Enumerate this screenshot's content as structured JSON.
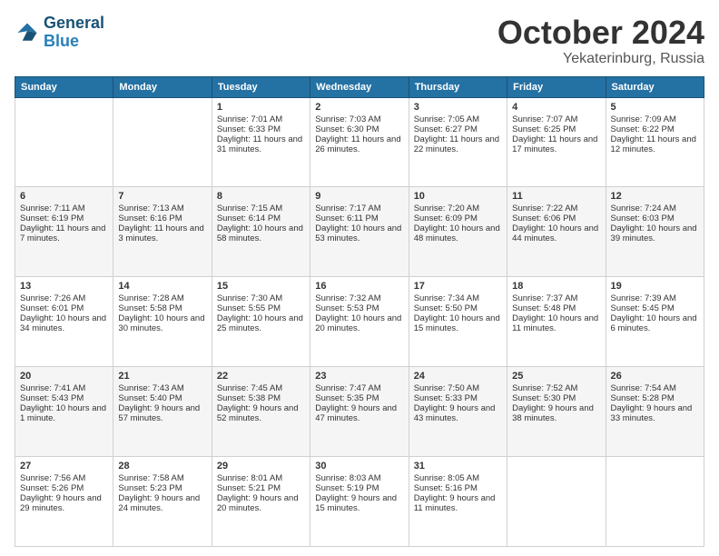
{
  "logo": {
    "line1": "General",
    "line2": "Blue"
  },
  "header": {
    "month": "October 2024",
    "location": "Yekaterinburg, Russia"
  },
  "weekdays": [
    "Sunday",
    "Monday",
    "Tuesday",
    "Wednesday",
    "Thursday",
    "Friday",
    "Saturday"
  ],
  "weeks": [
    [
      {
        "day": "",
        "data": ""
      },
      {
        "day": "",
        "data": ""
      },
      {
        "day": "1",
        "data": "Sunrise: 7:01 AM\nSunset: 6:33 PM\nDaylight: 11 hours and 31 minutes."
      },
      {
        "day": "2",
        "data": "Sunrise: 7:03 AM\nSunset: 6:30 PM\nDaylight: 11 hours and 26 minutes."
      },
      {
        "day": "3",
        "data": "Sunrise: 7:05 AM\nSunset: 6:27 PM\nDaylight: 11 hours and 22 minutes."
      },
      {
        "day": "4",
        "data": "Sunrise: 7:07 AM\nSunset: 6:25 PM\nDaylight: 11 hours and 17 minutes."
      },
      {
        "day": "5",
        "data": "Sunrise: 7:09 AM\nSunset: 6:22 PM\nDaylight: 11 hours and 12 minutes."
      }
    ],
    [
      {
        "day": "6",
        "data": "Sunrise: 7:11 AM\nSunset: 6:19 PM\nDaylight: 11 hours and 7 minutes."
      },
      {
        "day": "7",
        "data": "Sunrise: 7:13 AM\nSunset: 6:16 PM\nDaylight: 11 hours and 3 minutes."
      },
      {
        "day": "8",
        "data": "Sunrise: 7:15 AM\nSunset: 6:14 PM\nDaylight: 10 hours and 58 minutes."
      },
      {
        "day": "9",
        "data": "Sunrise: 7:17 AM\nSunset: 6:11 PM\nDaylight: 10 hours and 53 minutes."
      },
      {
        "day": "10",
        "data": "Sunrise: 7:20 AM\nSunset: 6:09 PM\nDaylight: 10 hours and 48 minutes."
      },
      {
        "day": "11",
        "data": "Sunrise: 7:22 AM\nSunset: 6:06 PM\nDaylight: 10 hours and 44 minutes."
      },
      {
        "day": "12",
        "data": "Sunrise: 7:24 AM\nSunset: 6:03 PM\nDaylight: 10 hours and 39 minutes."
      }
    ],
    [
      {
        "day": "13",
        "data": "Sunrise: 7:26 AM\nSunset: 6:01 PM\nDaylight: 10 hours and 34 minutes."
      },
      {
        "day": "14",
        "data": "Sunrise: 7:28 AM\nSunset: 5:58 PM\nDaylight: 10 hours and 30 minutes."
      },
      {
        "day": "15",
        "data": "Sunrise: 7:30 AM\nSunset: 5:55 PM\nDaylight: 10 hours and 25 minutes."
      },
      {
        "day": "16",
        "data": "Sunrise: 7:32 AM\nSunset: 5:53 PM\nDaylight: 10 hours and 20 minutes."
      },
      {
        "day": "17",
        "data": "Sunrise: 7:34 AM\nSunset: 5:50 PM\nDaylight: 10 hours and 15 minutes."
      },
      {
        "day": "18",
        "data": "Sunrise: 7:37 AM\nSunset: 5:48 PM\nDaylight: 10 hours and 11 minutes."
      },
      {
        "day": "19",
        "data": "Sunrise: 7:39 AM\nSunset: 5:45 PM\nDaylight: 10 hours and 6 minutes."
      }
    ],
    [
      {
        "day": "20",
        "data": "Sunrise: 7:41 AM\nSunset: 5:43 PM\nDaylight: 10 hours and 1 minute."
      },
      {
        "day": "21",
        "data": "Sunrise: 7:43 AM\nSunset: 5:40 PM\nDaylight: 9 hours and 57 minutes."
      },
      {
        "day": "22",
        "data": "Sunrise: 7:45 AM\nSunset: 5:38 PM\nDaylight: 9 hours and 52 minutes."
      },
      {
        "day": "23",
        "data": "Sunrise: 7:47 AM\nSunset: 5:35 PM\nDaylight: 9 hours and 47 minutes."
      },
      {
        "day": "24",
        "data": "Sunrise: 7:50 AM\nSunset: 5:33 PM\nDaylight: 9 hours and 43 minutes."
      },
      {
        "day": "25",
        "data": "Sunrise: 7:52 AM\nSunset: 5:30 PM\nDaylight: 9 hours and 38 minutes."
      },
      {
        "day": "26",
        "data": "Sunrise: 7:54 AM\nSunset: 5:28 PM\nDaylight: 9 hours and 33 minutes."
      }
    ],
    [
      {
        "day": "27",
        "data": "Sunrise: 7:56 AM\nSunset: 5:26 PM\nDaylight: 9 hours and 29 minutes."
      },
      {
        "day": "28",
        "data": "Sunrise: 7:58 AM\nSunset: 5:23 PM\nDaylight: 9 hours and 24 minutes."
      },
      {
        "day": "29",
        "data": "Sunrise: 8:01 AM\nSunset: 5:21 PM\nDaylight: 9 hours and 20 minutes."
      },
      {
        "day": "30",
        "data": "Sunrise: 8:03 AM\nSunset: 5:19 PM\nDaylight: 9 hours and 15 minutes."
      },
      {
        "day": "31",
        "data": "Sunrise: 8:05 AM\nSunset: 5:16 PM\nDaylight: 9 hours and 11 minutes."
      },
      {
        "day": "",
        "data": ""
      },
      {
        "day": "",
        "data": ""
      }
    ]
  ]
}
